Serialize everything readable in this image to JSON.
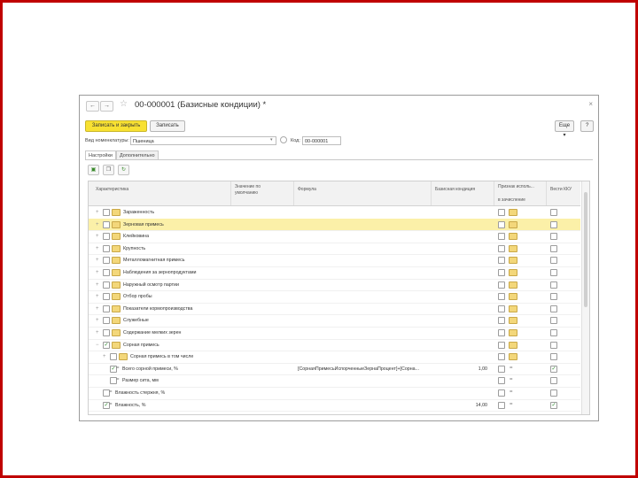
{
  "window": {
    "title": "00-000001 (Базисные кондиции) *",
    "back_glyph": "←",
    "forward_glyph": "→",
    "star_glyph": "☆",
    "close_glyph": "×"
  },
  "toolbar": {
    "save_close": "Записать и закрыть",
    "save": "Записать",
    "more": "Еще ▾",
    "help": "?"
  },
  "form": {
    "nomenclature_label": "Вид номенклатуры:",
    "nomenclature_value": "Пшеница",
    "code_label": "Код:",
    "code_value": "00-000001"
  },
  "tabs": [
    "Настройки",
    "Дополнительно"
  ],
  "grid_toolbar": [
    "add-icon",
    "copy-icon",
    "refresh-icon"
  ],
  "grid": {
    "headers": {
      "char": "Характеристика",
      "default": "Значение по умолчанию",
      "formula": "Формула",
      "base": "Базисная кондиция",
      "sign": "Признак исполь...",
      "sign_sub": "в зачисление",
      "kku": "Вести ККУ"
    },
    "rows": [
      {
        "name": "Зараженность",
        "level": 0,
        "expander": "+",
        "folder": true,
        "checked": false,
        "formula": "",
        "base": "",
        "selected": false,
        "sign_folder": true,
        "kku": false
      },
      {
        "name": "Зерновая примесь",
        "level": 0,
        "expander": "+",
        "folder": true,
        "checked": false,
        "formula": "",
        "base": "",
        "selected": true,
        "sign_folder": true,
        "kku": false
      },
      {
        "name": "Клейковина",
        "level": 0,
        "expander": "+",
        "folder": true,
        "checked": false,
        "formula": "",
        "base": "",
        "selected": false,
        "sign_folder": true,
        "kku": false
      },
      {
        "name": "Крупность",
        "level": 0,
        "expander": "+",
        "folder": true,
        "checked": false,
        "formula": "",
        "base": "",
        "selected": false,
        "sign_folder": true,
        "kku": false
      },
      {
        "name": "Металломагнитная примесь",
        "level": 0,
        "expander": "+",
        "folder": true,
        "checked": false,
        "formula": "",
        "base": "",
        "selected": false,
        "sign_folder": true,
        "kku": false
      },
      {
        "name": "Наблюдения за зернопродуктами",
        "level": 0,
        "expander": "+",
        "folder": true,
        "checked": false,
        "formula": "",
        "base": "",
        "selected": false,
        "sign_folder": true,
        "kku": false
      },
      {
        "name": "Наружный осмотр партии",
        "level": 0,
        "expander": "+",
        "folder": true,
        "checked": false,
        "formula": "",
        "base": "",
        "selected": false,
        "sign_folder": true,
        "kku": false
      },
      {
        "name": "Отбор пробы",
        "level": 0,
        "expander": "+",
        "folder": true,
        "checked": false,
        "formula": "",
        "base": "",
        "selected": false,
        "sign_folder": true,
        "kku": false
      },
      {
        "name": "Показатели кормопроизводства",
        "level": 0,
        "expander": "+",
        "folder": true,
        "checked": false,
        "formula": "",
        "base": "",
        "selected": false,
        "sign_folder": true,
        "kku": false
      },
      {
        "name": "Служебные",
        "level": 0,
        "expander": "+",
        "folder": true,
        "checked": false,
        "formula": "",
        "base": "",
        "selected": false,
        "sign_folder": true,
        "kku": false
      },
      {
        "name": "Содержание мелких зерен",
        "level": 0,
        "expander": "+",
        "folder": true,
        "checked": false,
        "formula": "",
        "base": "",
        "selected": false,
        "sign_folder": true,
        "kku": false
      },
      {
        "name": "Сорная примесь",
        "level": 0,
        "expander": "−",
        "folder": true,
        "checked": true,
        "formula": "",
        "base": "",
        "selected": false,
        "sign_folder": true,
        "kku": false
      },
      {
        "name": "Сорная примесь в том числе",
        "level": 1,
        "expander": "+",
        "folder": true,
        "checked": false,
        "formula": "",
        "base": "",
        "selected": false,
        "sign_folder": true,
        "kku": false
      },
      {
        "name": "Всего сорной примеси, %",
        "level": 1,
        "expander": "",
        "folder": false,
        "checked": true,
        "formula": "[СорнаяПримесьИспорченныеЗернаПроцент]+[Сорна...",
        "base": "1,00",
        "selected": false,
        "sign_folder": false,
        "kku": true
      },
      {
        "name": "Размер сита, мм",
        "level": 1,
        "expander": "",
        "folder": false,
        "checked": false,
        "formula": "",
        "base": "",
        "selected": false,
        "sign_folder": false,
        "kku": false
      },
      {
        "name": "Влажность стержня, %",
        "level": 0,
        "expander": "",
        "folder": false,
        "checked": false,
        "formula": "",
        "base": "",
        "selected": false,
        "sign_folder": false,
        "kku": false
      },
      {
        "name": "Влажность, %",
        "level": 0,
        "expander": "",
        "folder": false,
        "checked": true,
        "formula": "",
        "base": "14,00",
        "selected": false,
        "sign_folder": false,
        "kku": true
      }
    ]
  },
  "colors": {
    "frame_border": "#c00000",
    "primary_button": "#f8e132",
    "selected_row": "#fbf0a8"
  }
}
